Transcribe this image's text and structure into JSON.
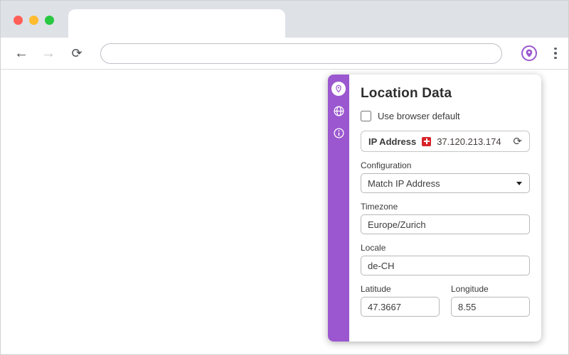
{
  "colors": {
    "accent": "#9b57cf",
    "flag_red": "#d8232a",
    "tab_strip": "#dee1e6"
  },
  "browser": {
    "address": {
      "value": "",
      "placeholder": ""
    },
    "icons": {
      "back": "←",
      "forward": "→",
      "reload": "⟳",
      "menu": "⋮",
      "refresh": "⟳"
    }
  },
  "panel": {
    "sidebar": {
      "items": [
        {
          "name": "location",
          "active": true
        },
        {
          "name": "globe",
          "active": false
        },
        {
          "name": "info",
          "active": false
        }
      ]
    },
    "title": "Location Data",
    "checkbox_label": "Use browser default",
    "ip": {
      "label": "IP Address",
      "flag": "switzerland-flag",
      "value": "37.120.213.174"
    },
    "fields": {
      "configuration": {
        "label": "Configuration",
        "value": "Match IP Address"
      },
      "timezone": {
        "label": "Timezone",
        "value": "Europe/Zurich"
      },
      "locale": {
        "label": "Locale",
        "value": "de-CH"
      },
      "latitude": {
        "label": "Latitude",
        "value": "47.3667"
      },
      "longitude": {
        "label": "Longitude",
        "value": "8.55"
      }
    }
  }
}
